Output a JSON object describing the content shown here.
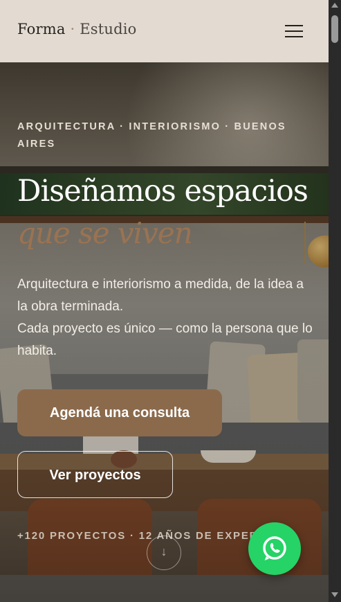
{
  "header": {
    "brand_primary": "Forma",
    "brand_separator": "·",
    "brand_secondary": "Estudio",
    "menu_icon": "hamburger-menu-icon"
  },
  "hero": {
    "eyebrow": "ARQUITECTURA · INTERIORISMO · BUENOS AIRES",
    "title_line1": "Diseñamos espacios",
    "title_line2": "que se viven",
    "lead_line1": "Arquitectura e interiorismo a medida, de la idea a la obra terminada.",
    "lead_line2": "Cada proyecto es único — como la persona que lo habita.",
    "primary_cta": "Agendá una consulta",
    "secondary_cta": "Ver proyectos",
    "stats": "+120 PROYECTOS · 12 AÑOS DE EXPER",
    "scroll_icon": "arrow-down-icon"
  },
  "whatsapp": {
    "icon": "whatsapp-icon",
    "color": "#25d366"
  },
  "colors": {
    "header_bg": "#e3dbd2",
    "accent": "#8b6a4c",
    "accent_text": "#9a7352"
  }
}
